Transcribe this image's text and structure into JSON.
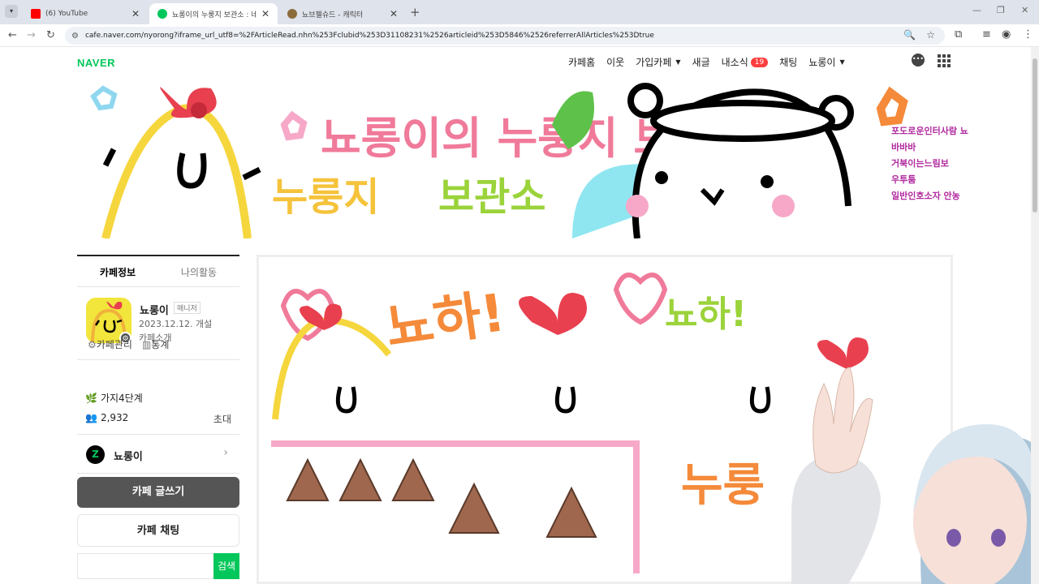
{
  "browser": {
    "tabs": [
      {
        "title": "(6) YouTube",
        "color": "#ff0000"
      },
      {
        "title": "뇨롱이의 누룽지 보관소 : 네이",
        "color": "#03c75a"
      },
      {
        "title": "뇨브젤슈드 - 캐릭터",
        "color": "#8a6d3b"
      }
    ],
    "new_tab": "+",
    "url": "cafe.naver.com/nyorong?iframe_url_utf8=%2FArticleRead.nhn%253Fclubid%253D31108231%2526articleid%253D5846%2526referrerAllArticles%253Dtrue"
  },
  "header": {
    "logo": "NAVER",
    "nav": [
      {
        "label": "카페홈"
      },
      {
        "label": "이웃"
      },
      {
        "label": "가입카페",
        "dropdown": true
      },
      {
        "label": "새글"
      },
      {
        "label": "내소식",
        "badge": "19"
      },
      {
        "label": "채팅"
      },
      {
        "label": "뇨롱이",
        "dropdown": true
      }
    ],
    "banner_title": "뇨롱이의 누룽지 보관소"
  },
  "sidebar": {
    "tabs": [
      "카페정보",
      "나의활동"
    ],
    "cafe_name": "뇨롱이",
    "role": "매니저",
    "founded": "2023.12.12. 개설",
    "intro": "카페소개",
    "manage": "카페관리",
    "stats": "통계",
    "rank": "가지4단계",
    "members": "2,932",
    "invite": "초대",
    "zep_name": "뇨롱이",
    "write_btn": "카페 글쓰기",
    "chat_btn": "카페 채팅",
    "search_btn": "검색",
    "search_placeholder": ""
  },
  "article": {
    "banner1": "뇨하!",
    "banner2": "누룽"
  },
  "stream_chat": [
    {
      "text": "포도로운인터사람 뇨"
    },
    {
      "text": "바바바"
    },
    {
      "text": "거북이는느림보"
    },
    {
      "text": "우투툼"
    },
    {
      "text": "일반인호소자 안농"
    }
  ],
  "colors": {
    "naver_green": "#03c75a",
    "badge_red": "#ff3d3d"
  }
}
